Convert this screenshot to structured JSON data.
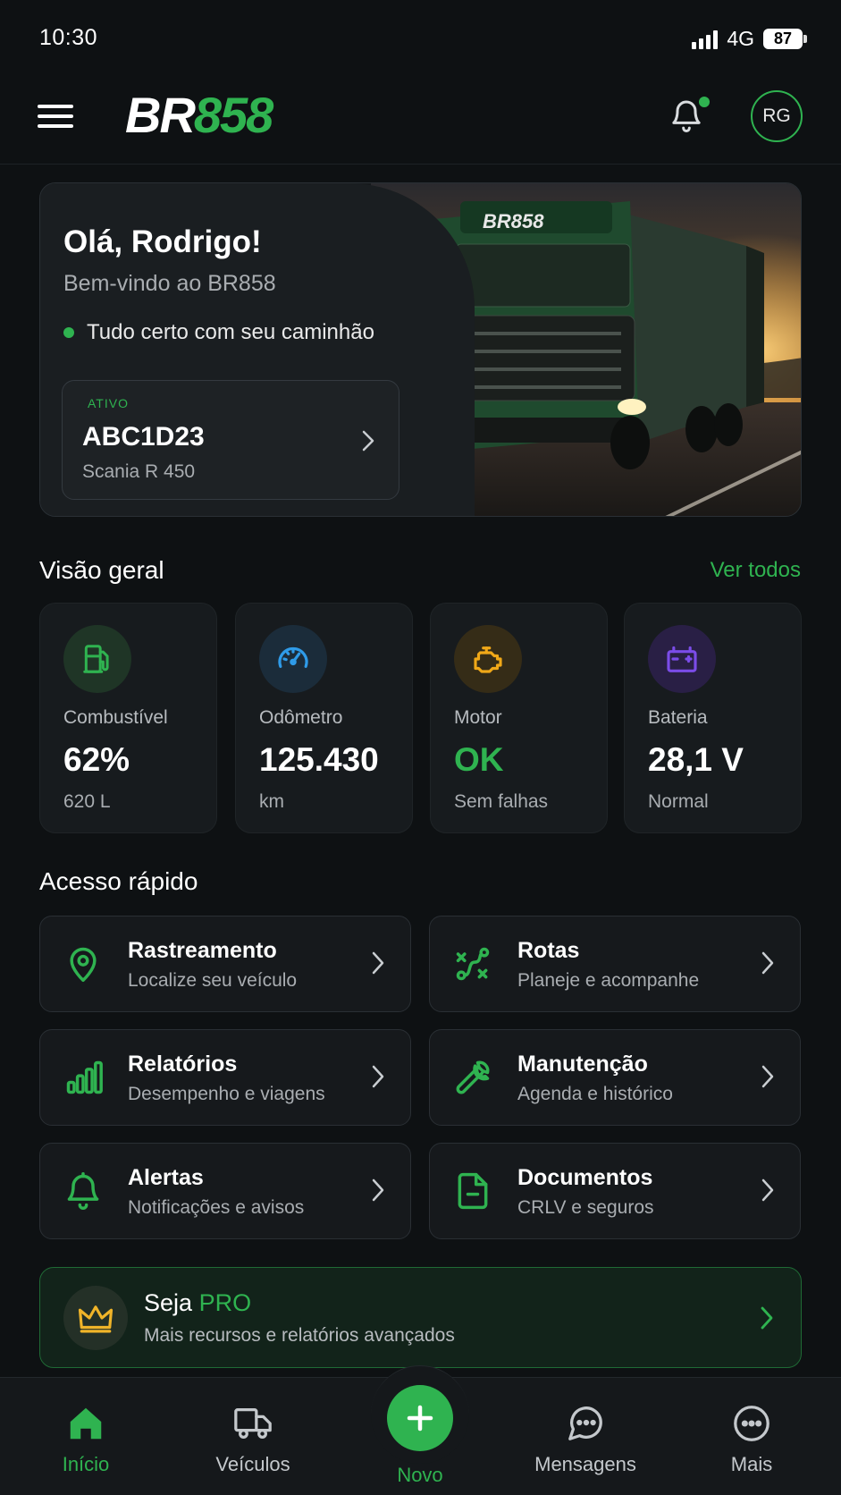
{
  "status_bar": {
    "time": "10:30",
    "network": "4G",
    "battery": "87"
  },
  "header": {
    "logo_part1": "BR",
    "logo_part2": "858",
    "avatar_initials": "RG",
    "has_notification": true
  },
  "hero": {
    "greeting": "Olá, Rodrigo!",
    "welcome": "Bem-vindo ao BR858",
    "status": "Tudo certo com seu caminhão",
    "truck_brand": "BR858",
    "vehicle": {
      "badge": "ATIVO",
      "plate": "ABC1D23",
      "model": "Scania R 450"
    }
  },
  "overview": {
    "title": "Visão geral",
    "see_all": "Ver todos",
    "stats": [
      {
        "label": "Combustível",
        "value": "62%",
        "sub": "620 L",
        "icon": "fuel-icon",
        "color": "#2fb350"
      },
      {
        "label": "Odômetro",
        "value": "125.430",
        "sub": "km",
        "icon": "speedometer-icon",
        "color": "#2f9be8"
      },
      {
        "label": "Motor",
        "value": "OK",
        "sub": "Sem falhas",
        "icon": "engine-icon",
        "color": "#f0a818"
      },
      {
        "label": "Bateria",
        "value": "28,1 V",
        "sub": "Normal",
        "icon": "battery-icon",
        "color": "#7b4ce8"
      }
    ]
  },
  "quick_access": {
    "title": "Acesso rápido",
    "items": [
      {
        "title": "Rastreamento",
        "sub": "Localize seu veículo",
        "icon": "location-pin-icon"
      },
      {
        "title": "Rotas",
        "sub": "Planeje e acompanhe",
        "icon": "route-icon"
      },
      {
        "title": "Relatórios",
        "sub": "Desempenho e viagens",
        "icon": "bar-chart-icon"
      },
      {
        "title": "Manutenção",
        "sub": "Agenda e histórico",
        "icon": "wrench-icon"
      },
      {
        "title": "Alertas",
        "sub": "Notificações e avisos",
        "icon": "bell-icon"
      },
      {
        "title": "Documentos",
        "sub": "CRLV e seguros",
        "icon": "document-icon"
      }
    ]
  },
  "pro_banner": {
    "title_prefix": "Seja",
    "title_accent": "PRO",
    "sub": "Mais recursos e relatórios avançados"
  },
  "bottom_nav": {
    "items": [
      {
        "label": "Início",
        "icon": "home-icon",
        "active": true
      },
      {
        "label": "Veículos",
        "icon": "truck-icon"
      },
      {
        "label": "Novo",
        "icon": "plus-icon"
      },
      {
        "label": "Mensagens",
        "icon": "chat-icon"
      },
      {
        "label": "Mais",
        "icon": "more-icon"
      }
    ]
  },
  "colors": {
    "accent": "#2fb350",
    "background": "#0e1113",
    "card": "#171b1e"
  }
}
